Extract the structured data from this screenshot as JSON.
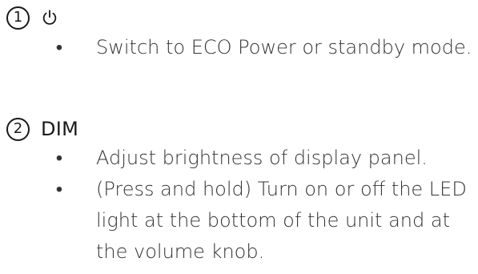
{
  "items": [
    {
      "number": "1",
      "title": "",
      "icon": "power-icon",
      "bullets": [
        "Switch to ECO Power or standby mode."
      ]
    },
    {
      "number": "2",
      "title": "DIM",
      "bullets": [
        "Adjust brightness of display panel.",
        "(Press and hold) Turn on or off the LED light at the bottom of the unit and at the volume knob."
      ]
    }
  ],
  "bullet_glyph": "•"
}
